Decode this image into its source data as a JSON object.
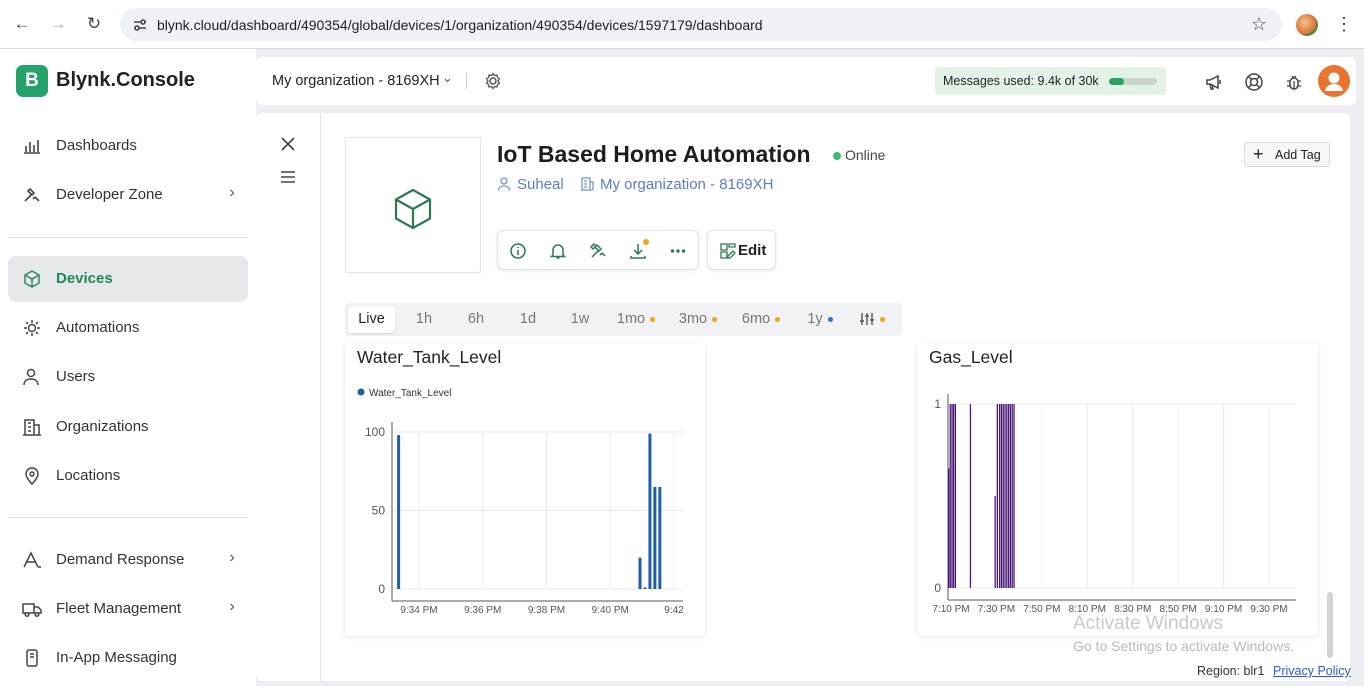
{
  "browser": {
    "url": "blynk.cloud/dashboard/490354/global/devices/1/organization/490354/devices/1597179/dashboard"
  },
  "sidebar": {
    "logo_letter": "B",
    "logo_text": "Blynk.Console",
    "items": [
      {
        "label": "Dashboards",
        "icon": "dashboards-icon"
      },
      {
        "label": "Developer Zone",
        "icon": "developer-zone-icon"
      },
      {
        "label": "Devices",
        "icon": "devices-icon",
        "active": true
      },
      {
        "label": "Automations",
        "icon": "automations-icon"
      },
      {
        "label": "Users",
        "icon": "users-icon"
      },
      {
        "label": "Organizations",
        "icon": "organizations-icon"
      },
      {
        "label": "Locations",
        "icon": "locations-icon"
      },
      {
        "label": "Demand Response",
        "icon": "demand-response-icon"
      },
      {
        "label": "Fleet Management",
        "icon": "fleet-management-icon"
      },
      {
        "label": "In-App Messaging",
        "icon": "in-app-messaging-icon"
      }
    ]
  },
  "topbar": {
    "org_name": "My organization - 8169XH",
    "messages_label": "Messages used:",
    "messages_value": "9.4k of 30k",
    "messages_fraction": 0.31
  },
  "device": {
    "title": "IoT Based Home Automation",
    "status": "Online",
    "owner": "Suheal",
    "organization": "My organization - 8169XH",
    "add_tag_label": "Add Tag",
    "edit_label": "Edit"
  },
  "time_ranges": [
    {
      "label": "Live",
      "active": true
    },
    {
      "label": "1h"
    },
    {
      "label": "6h"
    },
    {
      "label": "1d"
    },
    {
      "label": "1w"
    },
    {
      "label": "1mo",
      "dot": "#f0a219"
    },
    {
      "label": "3mo",
      "dot": "#f0a219"
    },
    {
      "label": "6mo",
      "dot": "#f0a219"
    },
    {
      "label": "1y",
      "dot": "#2b6fe0"
    }
  ],
  "colors": {
    "brand": "#23a36a",
    "water_series": "#1f5fa6",
    "gas_series": "#4b1a7a",
    "premium_dot": "#f0a219"
  },
  "chart_data": [
    {
      "type": "bar",
      "title": "Water_Tank_Level",
      "legend": [
        "Water_Tank_Level"
      ],
      "legend_position": "top-left",
      "x_ticks": [
        "9:34 PM",
        "9:36 PM",
        "9:38 PM",
        "9:40 PM",
        "9:42"
      ],
      "y_ticks": [
        0,
        50,
        100
      ],
      "ylim": [
        0,
        100
      ],
      "xlim_minutes": [
        33.5,
        42.3
      ],
      "x_minutes": [
        33.7,
        41.0,
        41.15,
        41.3,
        41.45,
        41.6
      ],
      "values": [
        98,
        20,
        1,
        99,
        65,
        65
      ],
      "grid": true
    },
    {
      "type": "bar",
      "title": "Gas_Level",
      "x_ticks": [
        "7:10 PM",
        "7:30 PM",
        "7:50 PM",
        "8:10 PM",
        "8:30 PM",
        "8:50 PM",
        "9:10 PM",
        "9:30 PM"
      ],
      "y_ticks": [
        0,
        1
      ],
      "ylim": [
        0,
        1
      ],
      "xlim_minutes": [
        1150,
        1305
      ],
      "x_minutes": [
        1150.3,
        1151,
        1151.8,
        1152.5,
        1153.3,
        1160,
        1171,
        1172,
        1173,
        1173.8,
        1174.6,
        1175.4,
        1176.2,
        1177,
        1177.8,
        1178.6,
        1179.4
      ],
      "values": [
        0.65,
        1,
        1,
        1,
        1,
        1,
        0.5,
        1,
        1,
        1,
        1,
        1,
        1,
        1,
        1,
        1,
        1
      ],
      "grid": true
    }
  ],
  "watermark": {
    "line1": "Activate Windows",
    "line2": "Go to Settings to activate Windows."
  },
  "footer": {
    "region": "Region: blr1",
    "privacy": "Privacy Policy"
  }
}
